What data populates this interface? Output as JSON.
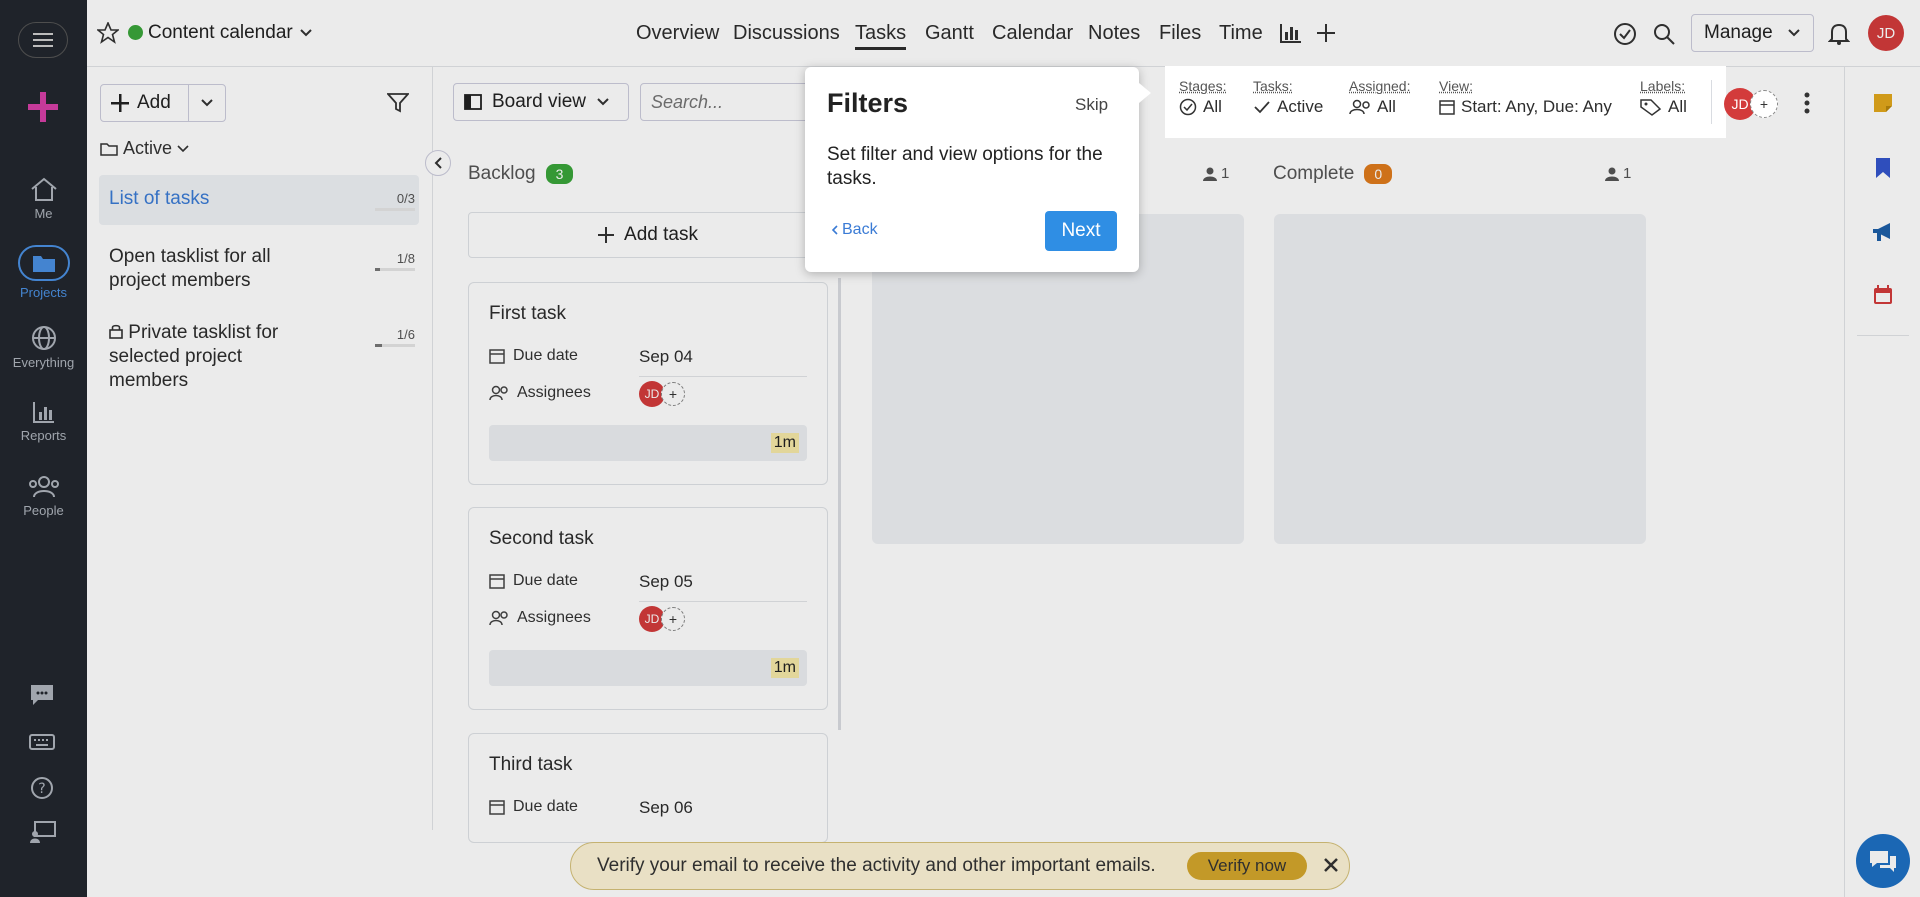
{
  "rail": {
    "items": [
      {
        "label": "Me",
        "icon": "home-icon"
      },
      {
        "label": "Projects",
        "icon": "folder-icon"
      },
      {
        "label": "Everything",
        "icon": "globe-icon"
      },
      {
        "label": "Reports",
        "icon": "bar-chart-icon"
      },
      {
        "label": "People",
        "icon": "people-icon"
      }
    ]
  },
  "project": {
    "name": "Content calendar",
    "status_color": "#3aa53a"
  },
  "nav": {
    "tabs": [
      "Overview",
      "Discussions",
      "Tasks",
      "Gantt",
      "Calendar",
      "Notes",
      "Files",
      "Time"
    ],
    "active": "Tasks",
    "manage_label": "Manage"
  },
  "user": {
    "initials": "JD"
  },
  "panel": {
    "add_label": "Add",
    "filter_label": "Active",
    "tasklists": [
      {
        "name": "List of tasks",
        "count": "0/3",
        "progress": 0.0
      },
      {
        "name": "Open tasklist for all project members",
        "count": "1/8",
        "progress": 0.125
      },
      {
        "name": "Private tasklist for selected project members",
        "count": "1/6",
        "progress": 0.167
      }
    ]
  },
  "board": {
    "view_label": "Board view",
    "search_placeholder": "Search...",
    "columns": [
      {
        "name": "Backlog",
        "count": "3",
        "badge_color": "#3aa53a"
      },
      {
        "name": "Complete",
        "count": "0",
        "badge_color": "#e07b1c",
        "members": "1"
      }
    ],
    "middle_members": "1",
    "add_task_label": "Add task",
    "due_label": "Due date",
    "assignees_label": "Assignees",
    "tasks": [
      {
        "title": "First task",
        "due": "Sep 04",
        "time": "1m"
      },
      {
        "title": "Second task",
        "due": "Sep 05",
        "time": "1m"
      },
      {
        "title": "Third task",
        "due": "Sep 06",
        "time": ""
      }
    ]
  },
  "filters": {
    "stages": {
      "label": "Stages:",
      "value": "All"
    },
    "tasks": {
      "label": "Tasks:",
      "value": "Active"
    },
    "assigned": {
      "label": "Assigned:",
      "value": "All"
    },
    "view": {
      "label": "View:",
      "value": "Start: Any, Due: Any"
    },
    "labels": {
      "label": "Labels:",
      "value": "All"
    }
  },
  "popover": {
    "title": "Filters",
    "skip": "Skip",
    "body": "Set filter and view options for the tasks.",
    "back": "Back",
    "next": "Next"
  },
  "banner": {
    "text": "Verify your email to receive the activity and other important emails.",
    "action": "Verify now"
  }
}
